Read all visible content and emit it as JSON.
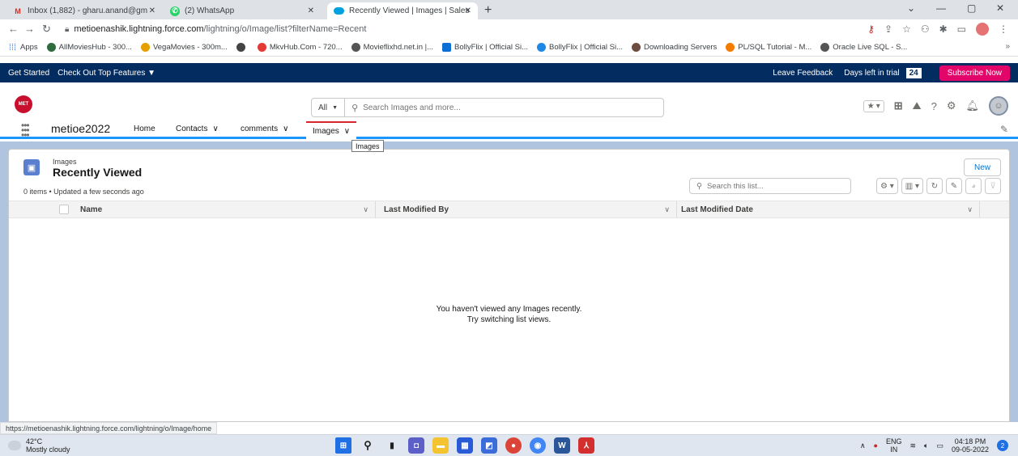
{
  "browser": {
    "tabs": [
      {
        "title": "Inbox (1,882) - gharu.anand@gm",
        "icon": "gmail-icon"
      },
      {
        "title": "(2) WhatsApp",
        "icon": "whatsapp-icon"
      },
      {
        "title": "Recently Viewed | Images | Sales",
        "icon": "salesforce-cloud-icon"
      }
    ],
    "url": {
      "host": "metioenashik.lightning.force.com",
      "path": "/lightning/o/Image/list?filterName=Recent"
    },
    "bookmarks": [
      {
        "label": "Apps",
        "color": "#4285f4"
      },
      {
        "label": "AllMoviesHub - 300...",
        "color": "#2f6b3f"
      },
      {
        "label": "VegaMovies - 300m...",
        "color": "#e6a100"
      },
      {
        "label": "",
        "color": "#444444"
      },
      {
        "label": "MkvHub.Com - 720...",
        "color": "#e53935"
      },
      {
        "label": "Movieflixhd.net.in |...",
        "color": "#555555"
      },
      {
        "label": "BollyFlix | Official Si...",
        "color": "#0b6fd6"
      },
      {
        "label": "BollyFlix | Official Si...",
        "color": "#1e88e5"
      },
      {
        "label": "Downloading Servers",
        "color": "#6d4c41"
      },
      {
        "label": "PL/SQL Tutorial - M...",
        "color": "#f57c00"
      },
      {
        "label": "Oracle Live SQL - S...",
        "color": "#555555"
      }
    ],
    "status_url": "https://metioenashik.lightning.force.com/lightning/o/Image/home"
  },
  "trial": {
    "get_started": "Get Started",
    "check_out": "Check Out Top Features ▼",
    "feedback": "Leave Feedback",
    "days_left_label": "Days left in trial",
    "days_left": "24",
    "subscribe": "Subscribe Now"
  },
  "header": {
    "logo_text": "MET",
    "search_scope": "All",
    "search_placeholder": "Search Images and more..."
  },
  "nav": {
    "app_name": "metioe2022",
    "items": [
      {
        "label": "Home"
      },
      {
        "label": "Contacts"
      },
      {
        "label": "comments"
      },
      {
        "label": "Images"
      }
    ],
    "tooltip": "Images"
  },
  "list": {
    "object_name": "Images",
    "view_name": "Recently Viewed",
    "new_label": "New",
    "meta": "0 items • Updated a few seconds ago",
    "search_placeholder": "Search this list...",
    "columns": [
      {
        "label": "Name"
      },
      {
        "label": "Last Modified By"
      },
      {
        "label": "Last Modified Date"
      }
    ],
    "empty_line1": "You haven't viewed any Images recently.",
    "empty_line2": "Try switching list views."
  },
  "taskbar": {
    "temp": "42°C",
    "weather": "Mostly cloudy",
    "lang1": "ENG",
    "lang2": "IN",
    "time": "04:18 PM",
    "date": "09-05-2022",
    "notifications": "2"
  },
  "colors": {
    "trial_bar": "#032d60",
    "subscribe": "#e3066a",
    "brand_blue": "#0176d3",
    "active_tab": "#d8272c"
  }
}
